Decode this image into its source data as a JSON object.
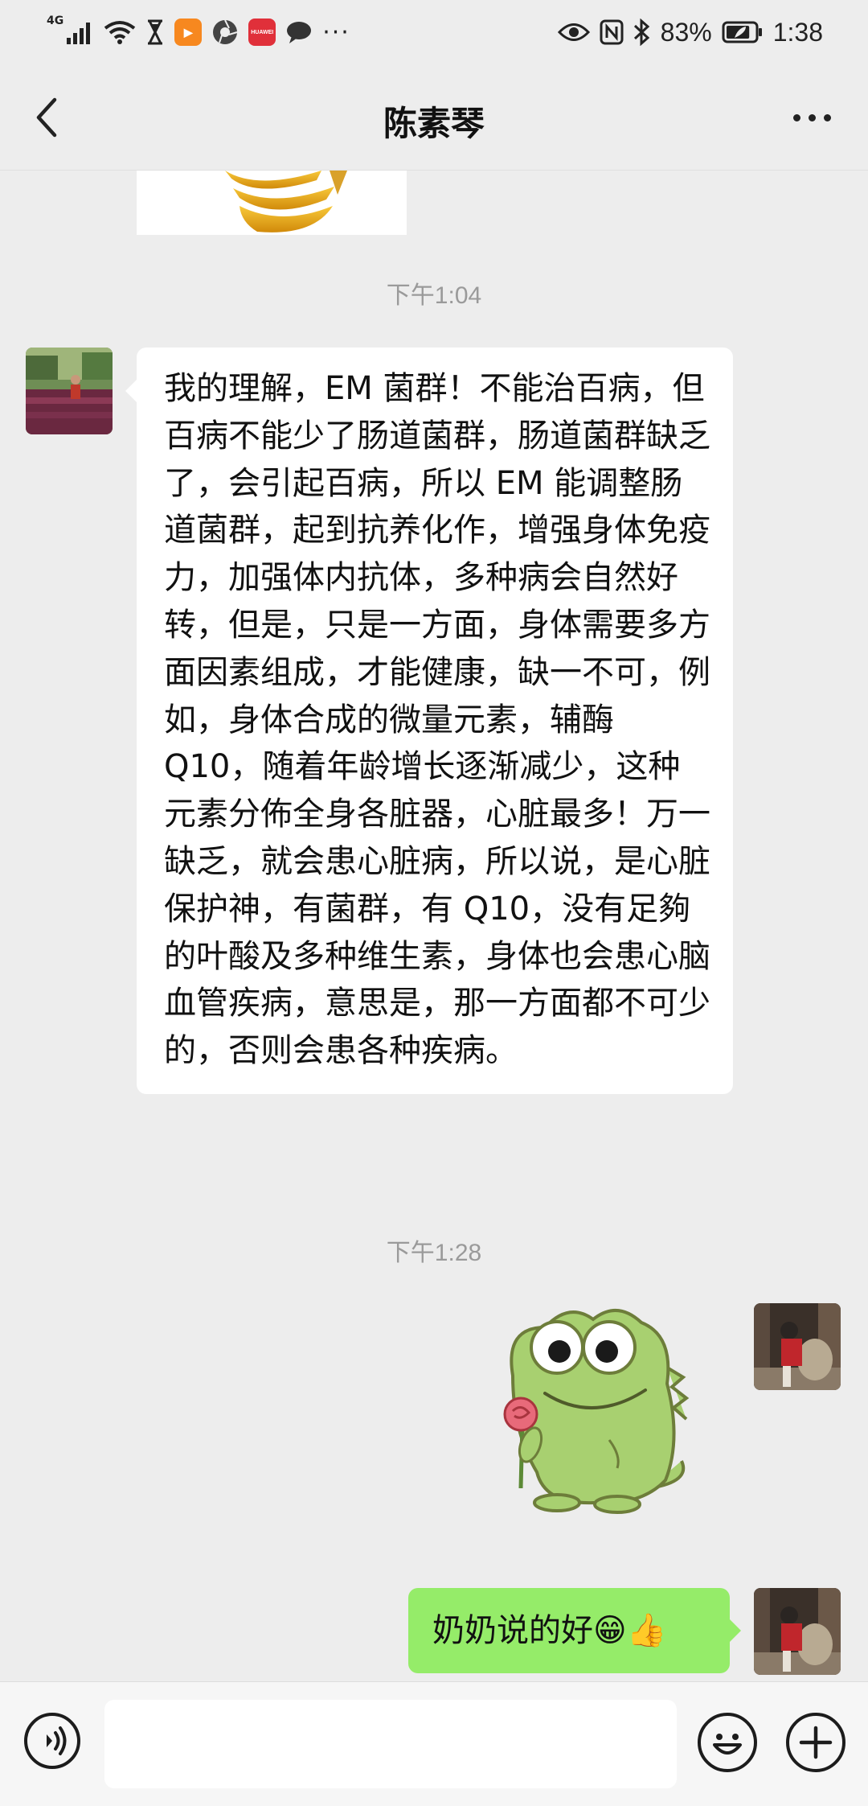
{
  "status_bar": {
    "network": "4G",
    "app_icons": [
      "hourglass-icon",
      "video-app-icon",
      "camera-app-icon",
      "huawei-app-icon",
      "chat-bubble-icon"
    ],
    "huawei_label": "HUAWEI",
    "more_dots": "···",
    "battery": "83%",
    "battery_level": 0.83,
    "time": "1:38"
  },
  "nav": {
    "title": "陈素琴"
  },
  "messages": {
    "time_1": "下午1:04",
    "incoming_text": "我的理解，EM 菌群！不能治百病，但百病不能少了肠道菌群，肠道菌群缺乏了，会引起百病，所以 EM 能调整肠道菌群，起到抗养化作，增强身体免疫力，加强体内抗体，多种病会自然好转，但是，只是一方面，身体需要多方面因素组成，才能健康，缺一不可，例如，身体合成的微量元素，辅酶 Q10，随着年龄增长逐渐减少，这种元素分佈全身各脏器，心脏最多！万一缺乏，就会患心脏病，所以说，是心脏保护神，有菌群，有 Q10，没有足夠的叶酸及多种维生素，身体也会患心脑血管疾病，意思是，那一方面都不可少的，否则会患各种疾病。",
    "time_2": "下午1:28",
    "outgoing_text": "奶奶说的好😁👍"
  },
  "input_bar": {
    "placeholder": "",
    "value": ""
  },
  "colors": {
    "background": "#ededed",
    "incoming_bubble": "#ffffff",
    "outgoing_bubble": "#95ec69",
    "timestamp": "#9a9a9a"
  }
}
